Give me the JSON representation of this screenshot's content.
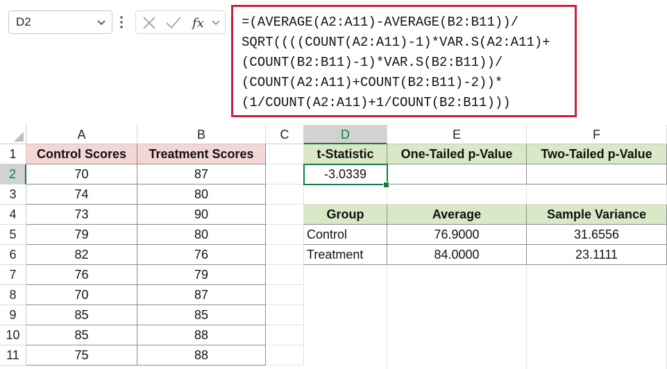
{
  "name_box": "D2",
  "formula_lines": [
    "=(AVERAGE(A2:A11)-AVERAGE(B2:B11))/",
    "SQRT((((COUNT(A2:A11)-1)*VAR.S(A2:A11)+",
    "(COUNT(B2:B11)-1)*VAR.S(B2:B11))/",
    "(COUNT(A2:A11)+COUNT(B2:B11)-2))*",
    "(1/COUNT(A2:A11)+1/COUNT(B2:B11)))"
  ],
  "columns": [
    "A",
    "B",
    "C",
    "D",
    "E",
    "F"
  ],
  "rows": [
    "1",
    "2",
    "3",
    "4",
    "5",
    "6",
    "7",
    "8",
    "9",
    "10",
    "11"
  ],
  "headers": {
    "a1": "Control Scores",
    "b1": "Treatment Scores",
    "d1": "t-Statistic",
    "e1": "One-Tailed p-Value",
    "f1": "Two-Tailed p-Value"
  },
  "control_scores": [
    "70",
    "74",
    "73",
    "79",
    "82",
    "76",
    "70",
    "85",
    "85",
    "75"
  ],
  "treatment_scores": [
    "87",
    "80",
    "90",
    "80",
    "76",
    "79",
    "87",
    "85",
    "88",
    "88"
  ],
  "t_statistic": "-3.0339",
  "summary": {
    "headers": [
      "Group",
      "Average",
      "Sample Variance"
    ],
    "rows": [
      [
        "Control",
        "76.9000",
        "31.6556"
      ],
      [
        "Treatment",
        "84.0000",
        "23.1111"
      ]
    ]
  },
  "colors": {
    "accent": "#107c41",
    "formula_border": "#cc2039",
    "pink": "#f5d6d6",
    "green": "#d9e8c6"
  },
  "icons": [
    "cancel-icon",
    "enter-icon",
    "fx-icon",
    "chevron-down-icon",
    "more-icon"
  ]
}
